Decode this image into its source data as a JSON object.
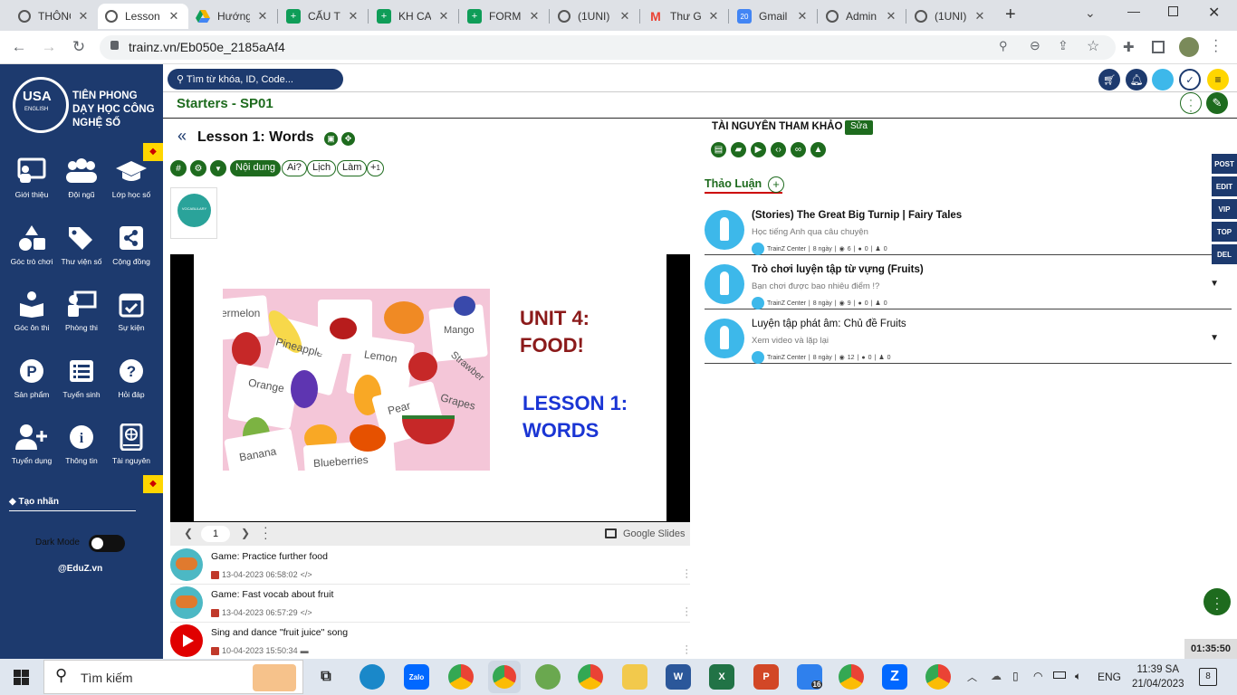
{
  "browser": {
    "tabs": [
      {
        "label": "THÔNG",
        "icon": "trainz-icon",
        "color": "#555555"
      },
      {
        "label": "Lesson",
        "icon": "trainz-icon",
        "color": "#555555"
      },
      {
        "label": "Hướng",
        "icon": "google-drive-icon",
        "color": "#f4b400"
      },
      {
        "label": "CẤU T",
        "icon": "google-sheets-icon",
        "color": "#0f9d58"
      },
      {
        "label": "KH CA",
        "icon": "google-sheets-icon",
        "color": "#0f9d58"
      },
      {
        "label": "FORM",
        "icon": "google-sheets-icon",
        "color": "#0f9d58"
      },
      {
        "label": "(1UNI)",
        "icon": "trainz-icon",
        "color": "#555555"
      },
      {
        "label": "Thư Gi",
        "icon": "gmail-icon",
        "color": "#ea4335"
      },
      {
        "label": "Gmail",
        "icon": "google-calendar-icon",
        "color": "#4285f4"
      },
      {
        "label": "Admin",
        "icon": "trainz-icon",
        "color": "#555555"
      },
      {
        "label": "(1UNI)",
        "icon": "trainz-icon",
        "color": "#555555"
      }
    ],
    "new_tab": "+",
    "url": "trainz.vn/Eb050e_2185aAf4"
  },
  "sidebar": {
    "brand_line1": "TIÊN PHONG",
    "brand_line2": "DẠY HỌC CÔNG",
    "brand_line3": "NGHỆ SỐ",
    "logo_text": "USA",
    "logo_sub": "ENGLISH",
    "items": [
      {
        "label": "Giới thiệu",
        "icon": "presentation-icon"
      },
      {
        "label": "Đội ngũ",
        "icon": "team-icon"
      },
      {
        "label": "Lớp học số",
        "icon": "graduation-cap-icon"
      },
      {
        "label": "Góc trò chơi",
        "icon": "shapes-icon"
      },
      {
        "label": "Thư viện số",
        "icon": "tags-icon"
      },
      {
        "label": "Cộng đồng",
        "icon": "share-icon"
      },
      {
        "label": "Góc ôn thi",
        "icon": "reader-icon"
      },
      {
        "label": "Phòng thi",
        "icon": "chalkboard-teacher-icon"
      },
      {
        "label": "Sự kiện",
        "icon": "calendar-check-icon"
      },
      {
        "label": "Sản phẩm",
        "icon": "product-p-icon"
      },
      {
        "label": "Tuyển sinh",
        "icon": "list-icon"
      },
      {
        "label": "Hỏi đáp",
        "icon": "question-icon"
      },
      {
        "label": "Tuyển dụng",
        "icon": "user-plus-icon"
      },
      {
        "label": "Thông tin",
        "icon": "info-icon"
      },
      {
        "label": "Tài nguyên",
        "icon": "book-globe-icon"
      }
    ],
    "tag_label": "Tạo nhãn",
    "dark_mode": "Dark Mode",
    "dark_mode_on": false,
    "footer": "@EduZ.vn"
  },
  "header": {
    "search_placeholder": "Tìm từ khóa, ID, Code...",
    "course": "Starters - SP01"
  },
  "lesson": {
    "back": "«",
    "title": "Lesson 1: Words",
    "pills": [
      "Nội dung",
      "Ai?",
      "Lịch",
      "Làm"
    ],
    "add_count": "1",
    "thumb_text": "VOCABULARY"
  },
  "slide": {
    "unit": "UNIT 4:",
    "topic": "FOOD!",
    "lesson": "LESSON 1:",
    "lesson_title": "WORDS",
    "card_words": [
      "ermelon",
      "Pineapple",
      "Lemon",
      "Mango",
      "Strawber",
      "Orange",
      "Pear",
      "Grapes",
      "Banana",
      "Blueberries"
    ],
    "page": "1",
    "provider": "Google Slides"
  },
  "activities": [
    {
      "title": "Game: Practice further food",
      "date": "13-04-2023 06:58:02",
      "type": "code"
    },
    {
      "title": "Game: Fast vocab about fruit",
      "date": "13-04-2023 06:57:29",
      "type": "code"
    },
    {
      "title": "Sing and dance \"fruit juice\" song",
      "date": "10-04-2023 15:50:34",
      "type": "video"
    }
  ],
  "resources": {
    "title": "TÀI NGUYÊN THAM KHẢO",
    "edit": "Sửa"
  },
  "discussion": {
    "title": "Thảo Luận",
    "posts": [
      {
        "title": "(Stories) The Great Big Turnip | Fairy Tales",
        "subtitle": "Học tiếng Anh qua câu chuyện",
        "author": "TrainZ Center",
        "age": "8 ngày",
        "views": "6",
        "comments": "0",
        "members": "0"
      },
      {
        "title": "Trò chơi luyện tập từ vựng (Fruits)",
        "subtitle": "Bạn chơi được bao nhiêu điểm !?",
        "author": "TrainZ Center",
        "age": "8 ngày",
        "views": "9",
        "comments": "0",
        "members": "0"
      },
      {
        "title": "Luyện tập phát âm: Chủ đề Fruits",
        "subtitle": "Xem video và lặp lại",
        "author": "TrainZ Center",
        "age": "8 ngày",
        "views": "12",
        "comments": "0",
        "members": "0"
      }
    ]
  },
  "side_tags": [
    "POST",
    "EDIT",
    "VIP",
    "TOP",
    "DEL"
  ],
  "timer": "01:35:50",
  "taskbar": {
    "search": "Tìm kiếm",
    "lang": "ENG",
    "time": "11:39 SA",
    "date": "21/04/2023",
    "notif": "8",
    "badge": "16"
  }
}
